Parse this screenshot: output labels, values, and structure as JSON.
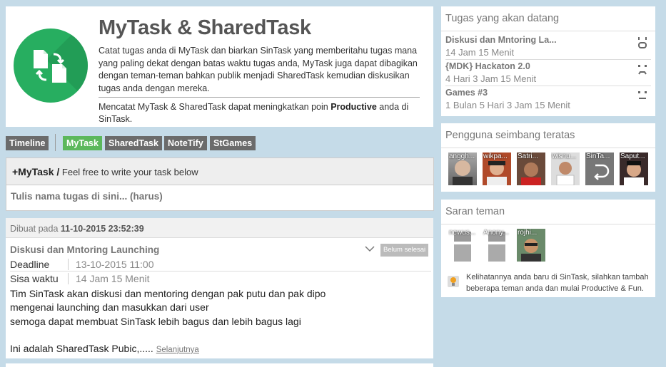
{
  "hero": {
    "title": "MyTask & SharedTask",
    "description": "Catat tugas anda di MyTask dan biarkan SinTask yang memberitahu tugas mana yang paling dekat dengan batas waktu tugas anda, MyTask juga dapat dibagikan dengan teman-teman bahkan publik menjadi SharedTask kemudian diskusikan tugas anda dengan mereka.",
    "note_before": "Mencatat MyTask & SharedTask dapat meningkatkan poin ",
    "note_bold": "Productive",
    "note_after": " anda di SinTask.",
    "logo_icon": "swap-documents-icon",
    "logo_color": "#27ae60"
  },
  "tabs": [
    {
      "label": "Timeline"
    },
    {
      "label": "MyTask"
    },
    {
      "label": "SharedTask"
    },
    {
      "label": "NoteTify"
    },
    {
      "label": "StGames"
    }
  ],
  "composer": {
    "prefix": "+MyTask /",
    "hint": " Feel free to write your task below",
    "placeholder": "Tulis nama tugas di sini... (harus)"
  },
  "task": {
    "created_label": "Dibuat pada ",
    "created_value": "11-10-2015 23:52:39",
    "title": "Diskusi dan Mntoring Launching",
    "status": "Belum selesai",
    "deadline_label": "Deadline",
    "deadline_value": "13-10-2015 11:00",
    "remaining_label": "Sisa waktu",
    "remaining_value": "14 Jam 15 Menit",
    "body_lines": [
      "Tim SinTask akan diskusi dan mentoring dengan pak putu dan pak dipo",
      "mengenai launching dan masukkan dari user",
      "semoga dapat membuat SinTask lebih bagus dan lebih bagus lagi",
      "",
      "Ini adalah SharedTask Pubic,....."
    ],
    "more_label": "Selanjutnya"
  },
  "upcoming": {
    "title": "Tugas yang akan datang",
    "items": [
      {
        "name": "Diskusi dan Mntoring La...",
        "time": "14 Jam 15 Menit",
        "face": "ᵔ̈"
      },
      {
        "name": "{MDK} Hackaton 2.0",
        "time": "4 Hari 3 Jam 15 Menit",
        "face": "☹"
      },
      {
        "name": "Games #3",
        "time": "1 Bulan 5 Hari 3 Jam 15 Menit",
        "face": "☹"
      }
    ]
  },
  "ranking": {
    "title": "Pengguna seimbang teratas",
    "users": [
      "anggh...",
      "wikpa...",
      "Satri...",
      "wisnu...",
      "SinTa...",
      "Saput..."
    ]
  },
  "suggest": {
    "title": "Saran teman",
    "users": [
      "newus...",
      "Anony...",
      "rojhi..."
    ],
    "message": "Kelihatannya anda baru di SinTask, silahkan tambah beberapa teman anda dan mulai Productive & Fun."
  }
}
